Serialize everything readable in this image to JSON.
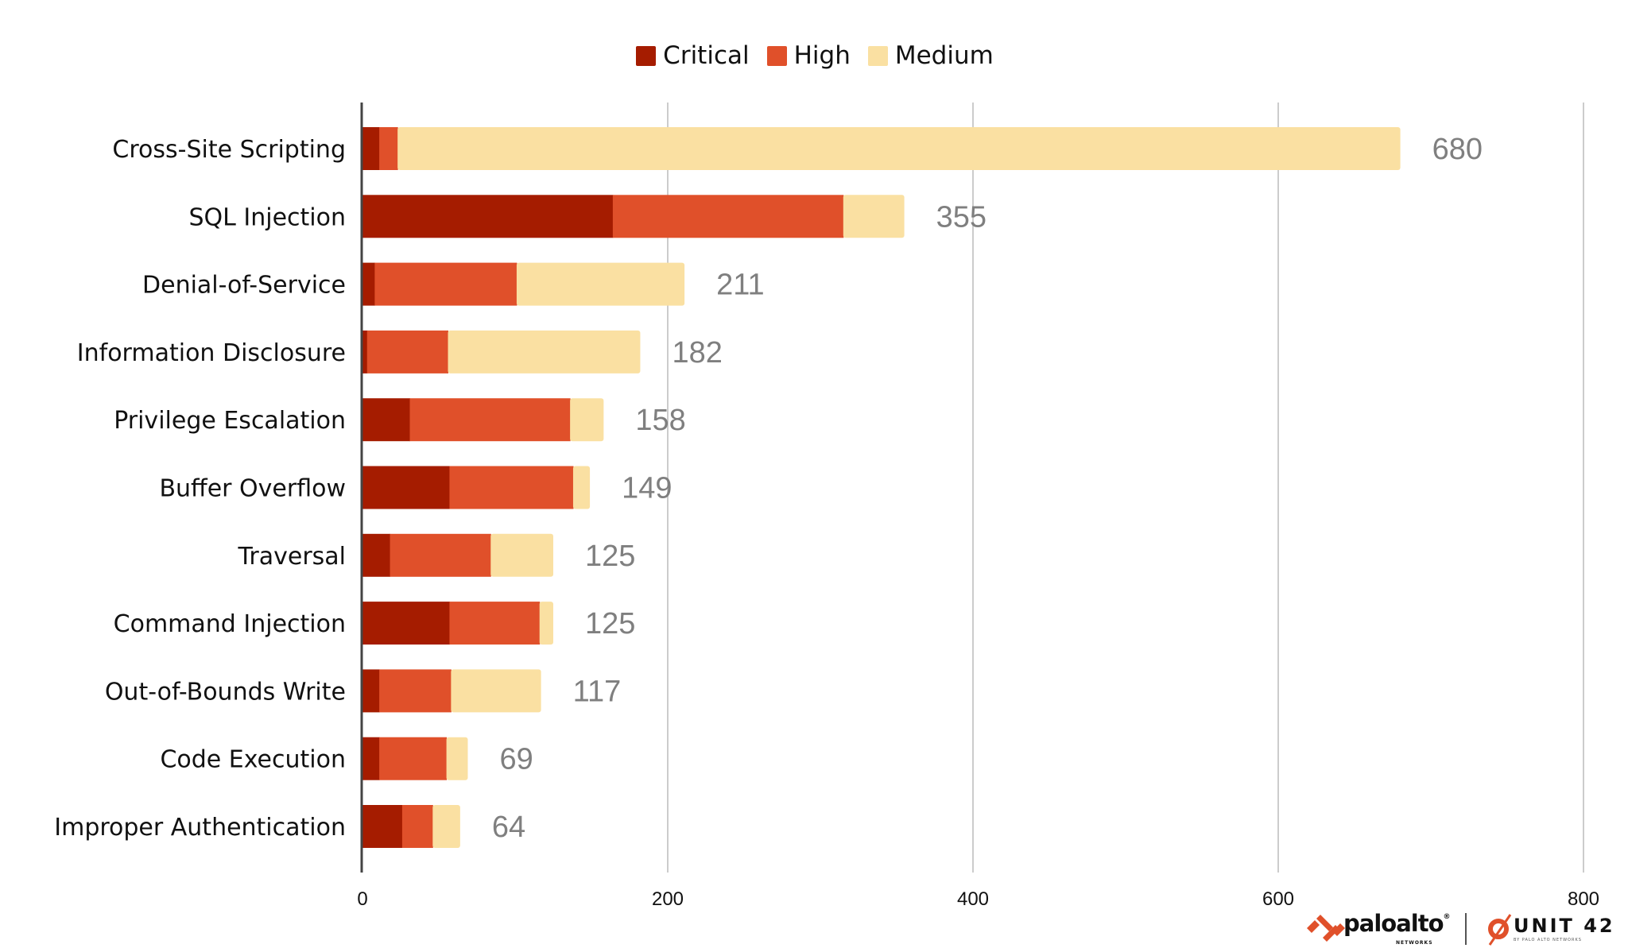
{
  "chart_data": {
    "type": "bar",
    "orientation": "horizontal",
    "stacked": true,
    "title": "",
    "xlabel": "",
    "ylabel": "",
    "xlim": [
      0,
      800
    ],
    "x_ticks": [
      0,
      200,
      400,
      600,
      800
    ],
    "x_tick_labels": [
      "0",
      "200",
      "400",
      "600",
      "800"
    ],
    "grid": "vertical",
    "legend_position": "top-center",
    "categories": [
      "Cross-Site Scripting",
      "SQL Injection",
      "Denial-of-Service",
      "Information Disclosure",
      "Privilege Escalation",
      "Buffer Overflow",
      "Traversal",
      "Command Injection",
      "Out-of-Bounds Write",
      "Code Execution",
      "Improper Authentication"
    ],
    "series": [
      {
        "name": "Critical",
        "color": "#A51C00",
        "values": [
          11,
          164,
          8,
          3,
          31,
          57,
          18,
          57,
          11,
          11,
          26
        ]
      },
      {
        "name": "High",
        "color": "#E0502A",
        "values": [
          12,
          151,
          93,
          53,
          105,
          81,
          66,
          59,
          47,
          44,
          20
        ]
      },
      {
        "name": "Medium",
        "color": "#FAE0A2",
        "values": [
          657,
          40,
          110,
          126,
          22,
          11,
          41,
          9,
          59,
          14,
          18
        ]
      }
    ],
    "totals": [
      680,
      355,
      211,
      182,
      158,
      149,
      125,
      125,
      117,
      69,
      64
    ],
    "total_labels": [
      "680",
      "355",
      "211",
      "182",
      "158",
      "149",
      "125",
      "125",
      "117",
      "69",
      "64"
    ]
  },
  "legend": {
    "items": [
      {
        "label": "Critical",
        "color": "#A51C00"
      },
      {
        "label": "High",
        "color": "#E0502A"
      },
      {
        "label": "Medium",
        "color": "#FAE0A2"
      }
    ]
  },
  "branding": {
    "paloalto": {
      "name": "paloalto",
      "sub": "NETWORKS",
      "color": "#E0502A"
    },
    "unit42": {
      "name": "UNIT 42",
      "sub": "BY PALO ALTO NETWORKS",
      "color": "#E0502A"
    }
  }
}
